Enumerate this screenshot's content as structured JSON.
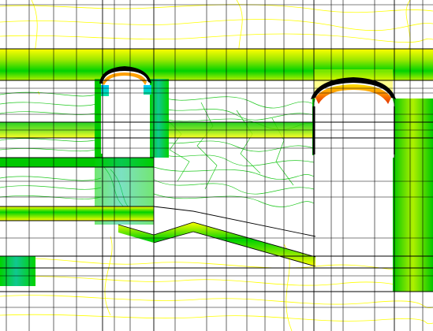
{
  "view": {
    "kind": "finite-element contour plot",
    "background": "#ffffff",
    "mesh_color": "#000000",
    "contour_palette": [
      "#ffff00",
      "#c8f000",
      "#78e600",
      "#00dc00",
      "#00c8c8",
      "#0096ff",
      "#ff8800",
      "#ff0000"
    ],
    "grid_lines_shown": true,
    "legend_shown": false,
    "text_labels_shown": false
  },
  "features": {
    "openings": [
      {
        "name": "left-arched-opening",
        "cap_colors": [
          "#000000",
          "#ffa000",
          "#00c8ff"
        ]
      },
      {
        "name": "right-arched-opening",
        "cap_colors": [
          "#000000",
          "#ff3000",
          "#ffa000"
        ]
      }
    ],
    "bands": [
      {
        "name": "upper-slab-band",
        "colors": [
          "#00dc00",
          "#c8f000"
        ]
      },
      {
        "name": "middle-slab-band",
        "colors": [
          "#00dc00",
          "#ffff00"
        ]
      },
      {
        "name": "sloped-floor-band",
        "colors": [
          "#00dc00",
          "#ffff00"
        ]
      },
      {
        "name": "right-column-band",
        "colors": [
          "#00dc00",
          "#00c8c8"
        ]
      }
    ]
  }
}
